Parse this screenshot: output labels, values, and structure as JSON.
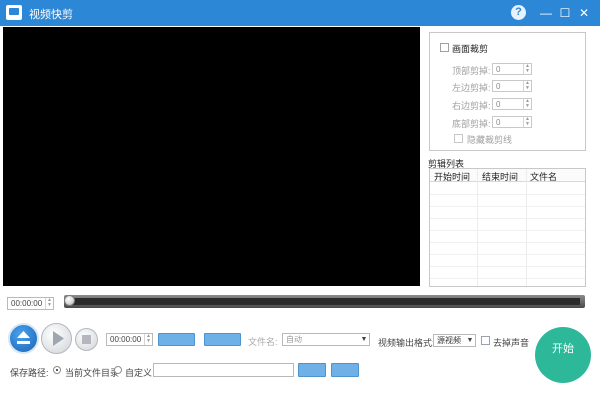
{
  "window": {
    "title": "视频快剪",
    "help_symbol": "?",
    "minimize_symbol": "—",
    "maximize_symbol": "☐",
    "close_symbol": "✕"
  },
  "crop": {
    "checkbox_label": "画面裁剪",
    "rows": [
      {
        "label": "顶部剪掉:",
        "value": "0"
      },
      {
        "label": "左边剪掉:",
        "value": "0"
      },
      {
        "label": "右边剪掉:",
        "value": "0"
      },
      {
        "label": "底部剪掉:",
        "value": "0"
      }
    ],
    "hide_line_label": "隐藏裁剪线"
  },
  "cut_list": {
    "title": "剪辑列表",
    "columns": [
      "开始时间",
      "结束时间",
      "文件名"
    ]
  },
  "player": {
    "current_time": "00:00:00",
    "progress": 0
  },
  "controls": {
    "clip_time": "00:00:00",
    "filename_label": "文件名:",
    "filename_value": "自动",
    "format_label": "视频输出格式:",
    "format_value": "源视频",
    "mute_label": "去掉声音",
    "start_label": "开始"
  },
  "save": {
    "path_label": "保存路径:",
    "option_current": "当前文件目录",
    "option_custom": "自定义"
  },
  "colors": {
    "titlebar": "#2c87d7",
    "accent_button": "#6fb0e6",
    "start_button": "#2db89a"
  }
}
